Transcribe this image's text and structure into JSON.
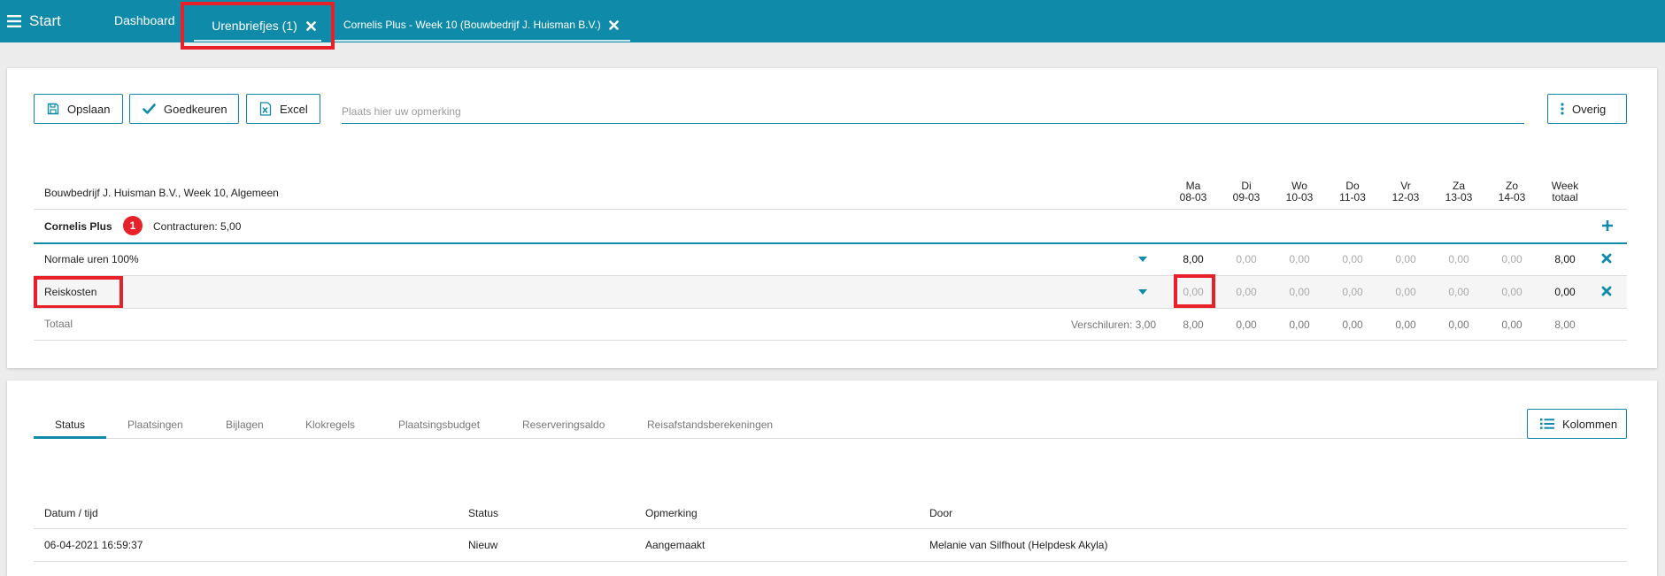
{
  "topbar": {
    "start_label": "Start",
    "tabs": [
      {
        "label": "Dashboard"
      },
      {
        "label": "Urenbriefjes (1)"
      },
      {
        "label": "Cornelis Plus - Week 10 (Bouwbedrijf J. Huisman B.V.)"
      }
    ]
  },
  "toolbar": {
    "save_label": "Opslaan",
    "approve_label": "Goedkeuren",
    "excel_label": "Excel",
    "remark_placeholder": "Plaats hier uw opmerking",
    "other_label": "Overig"
  },
  "timesheet": {
    "header_title": "Bouwbedrijf J. Huisman B.V., Week 10, Algemeen",
    "days": [
      {
        "day": "Ma",
        "date": "08-03"
      },
      {
        "day": "Di",
        "date": "09-03"
      },
      {
        "day": "Wo",
        "date": "10-03"
      },
      {
        "day": "Do",
        "date": "11-03"
      },
      {
        "day": "Vr",
        "date": "12-03"
      },
      {
        "day": "Za",
        "date": "13-03"
      },
      {
        "day": "Zo",
        "date": "14-03"
      }
    ],
    "week_total_label": [
      "Week",
      "totaal"
    ],
    "employee": {
      "name": "Cornelis Plus",
      "badge": "1",
      "contract": "Contracturen: 5,00"
    },
    "rows": [
      {
        "label": "Normale uren 100%",
        "values": [
          "8,00",
          "0,00",
          "0,00",
          "0,00",
          "0,00",
          "0,00",
          "0,00"
        ],
        "total": "8,00"
      },
      {
        "label": "Reiskosten",
        "values": [
          "0,00",
          "0,00",
          "0,00",
          "0,00",
          "0,00",
          "0,00",
          "0,00"
        ],
        "total": "0,00"
      }
    ],
    "totals": {
      "label": "Totaal",
      "difference": "Verschiluren: 3,00",
      "values": [
        "8,00",
        "0,00",
        "0,00",
        "0,00",
        "0,00",
        "0,00",
        "0,00"
      ],
      "total": "8,00"
    }
  },
  "detail": {
    "tabs": [
      "Status",
      "Plaatsingen",
      "Bijlagen",
      "Klokregels",
      "Plaatsingsbudget",
      "Reserveringsaldo",
      "Reisafstandsberekeningen"
    ],
    "columns_button": "Kolommen",
    "table": {
      "headers": [
        "Datum / tijd",
        "Status",
        "Opmerking",
        "Door"
      ],
      "rows": [
        [
          "06-04-2021 16:59:37",
          "Nieuw",
          "Aangemaakt",
          "Melanie van Silfhout (Helpdesk Akyla)"
        ]
      ]
    }
  },
  "colors": {
    "accent": "#0f8aa8",
    "highlight": "#e8202a"
  }
}
